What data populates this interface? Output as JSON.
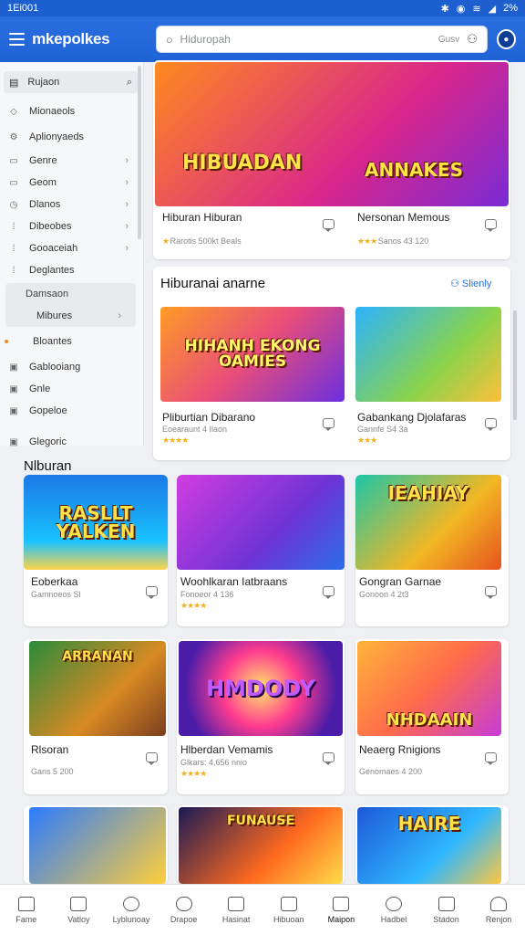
{
  "statusbar": {
    "time": "1Ei001",
    "icons": [
      "bluetooth-icon",
      "nfc-icon",
      "wifi-icon",
      "signal-icon"
    ],
    "battery": "2%"
  },
  "appbar": {
    "logo": "mkepolkes",
    "search_placeholder": "Hiduropah",
    "search_right": "Gusv"
  },
  "sidebar": {
    "search_label": "Rujaon",
    "items": [
      {
        "label": "Mionaeols",
        "icon": "tag-icon",
        "chev": false
      },
      {
        "label": "Aplionyaeds",
        "icon": "gear-icon",
        "chev": false
      },
      {
        "label": "Genre",
        "icon": "box-icon",
        "chev": true
      },
      {
        "label": "Geom",
        "icon": "grid-icon",
        "chev": true
      },
      {
        "label": "Dlanos",
        "icon": "clock-icon",
        "chev": true
      },
      {
        "label": "Dibeobes",
        "icon": "dots-icon",
        "chev": true
      },
      {
        "label": "Gooaceiah",
        "icon": "dots-icon",
        "chev": true
      },
      {
        "label": "Deglantes",
        "icon": "dots-icon",
        "chev": false
      }
    ],
    "sub_header": "Damsaon",
    "sub_item": "Mibures",
    "lower": [
      {
        "label": "Bloantes",
        "icon": "dot-icon"
      },
      {
        "label": "Gablooiang",
        "icon": "grid-icon"
      },
      {
        "label": "Gnle",
        "icon": "grid-icon"
      },
      {
        "label": "Gopeloe",
        "icon": "grid-icon"
      },
      {
        "label": "Glegoric",
        "icon": "grid-icon"
      }
    ]
  },
  "featured": [
    {
      "title": "Hiburan Hiburan",
      "meta": "Rarotis 500kt Beals"
    },
    {
      "title": "Nersonan Memous",
      "meta": "Sanos 43 120"
    }
  ],
  "featured_art": [
    "HIBUADAN",
    "ANNAKES"
  ],
  "section1": {
    "title": "Hiburanai anarne",
    "show": "Slienly"
  },
  "grid1": [
    {
      "title": "Pliburtian Dibarano",
      "meta": "Eoearaunt 4 Ilaon",
      "art": "HIHANH EKONG OAMIES"
    },
    {
      "title": "Gabankang Djolafaras",
      "meta": "Gannfe S4 3a",
      "art": ""
    }
  ],
  "section2": {
    "title": "Nlburan"
  },
  "grid2": [
    {
      "title": "Eoberkaa",
      "meta": "Gamnoeos Sl",
      "art": "RASLLT YALKEN"
    },
    {
      "title": "Woohlkaran Iatbraans",
      "meta": "Fonoeor 4 136",
      "art": ""
    },
    {
      "title": "Gongran Garnae",
      "meta": "Gonoon 4 2t3",
      "art": "IEAHIAY"
    },
    {
      "title": "Rlsoran",
      "meta": "Gans 5 200",
      "art": "ARRANAN"
    },
    {
      "title": "Hlberdan Vemamis",
      "meta": "Glkars: 4,656 nnio",
      "art": "HMDODY"
    },
    {
      "title": "Neaerg Rnigions",
      "meta": "Genomaes 4 200",
      "art": "NHDAAIN"
    },
    {
      "title": "",
      "meta": "",
      "art": ""
    },
    {
      "title": "",
      "meta": "",
      "art": "FUNAUSE"
    },
    {
      "title": "",
      "meta": "",
      "art": "HAIRE"
    }
  ],
  "bottom_nav": [
    {
      "label": "Fame",
      "icon": "home-icon"
    },
    {
      "label": "Vatloy",
      "icon": "square-icon"
    },
    {
      "label": "Lyblunoay",
      "icon": "chat-icon"
    },
    {
      "label": "Drapoe",
      "icon": "gamepad-icon"
    },
    {
      "label": "Hasinat",
      "icon": "book-icon"
    },
    {
      "label": "Hibuoan",
      "icon": "media-icon"
    },
    {
      "label": "Maipon",
      "icon": "card-icon"
    },
    {
      "label": "Hadbel",
      "icon": "chat-bubble-icon"
    },
    {
      "label": "Stadon",
      "icon": "store-icon"
    },
    {
      "label": "Renjon",
      "icon": "person-icon"
    }
  ],
  "colors": {
    "accent": "#1f62d6",
    "star": "#f2b01e",
    "link": "#2a6fe0"
  }
}
